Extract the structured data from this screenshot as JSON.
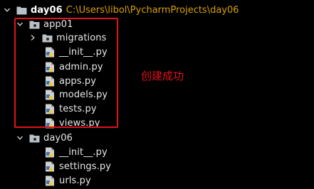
{
  "project": {
    "name": "day06",
    "path": "C:\\Users\\libol\\PycharmProjects\\day06"
  },
  "tree": [
    {
      "label": "app01",
      "type": "package",
      "expanded": true
    },
    {
      "label": "migrations",
      "type": "package",
      "expanded": false
    },
    {
      "label": "__init__.py",
      "type": "python-file"
    },
    {
      "label": "admin.py",
      "type": "python-file"
    },
    {
      "label": "apps.py",
      "type": "python-file"
    },
    {
      "label": "models.py",
      "type": "python-file"
    },
    {
      "label": "tests.py",
      "type": "python-file"
    },
    {
      "label": "views.py",
      "type": "python-file"
    },
    {
      "label": "day06",
      "type": "package",
      "expanded": true
    },
    {
      "label": "__init__.py",
      "type": "python-file"
    },
    {
      "label": "settings.py",
      "type": "python-file"
    },
    {
      "label": "urls.py",
      "type": "python-file"
    }
  ],
  "annotation": {
    "text": "创建成功",
    "color": "#e0121a"
  },
  "colors": {
    "background": "#000000",
    "text": "#e8e8e8",
    "path": "#d8a000",
    "annotation": "#e0121a",
    "folder": "#b9c0c6"
  }
}
